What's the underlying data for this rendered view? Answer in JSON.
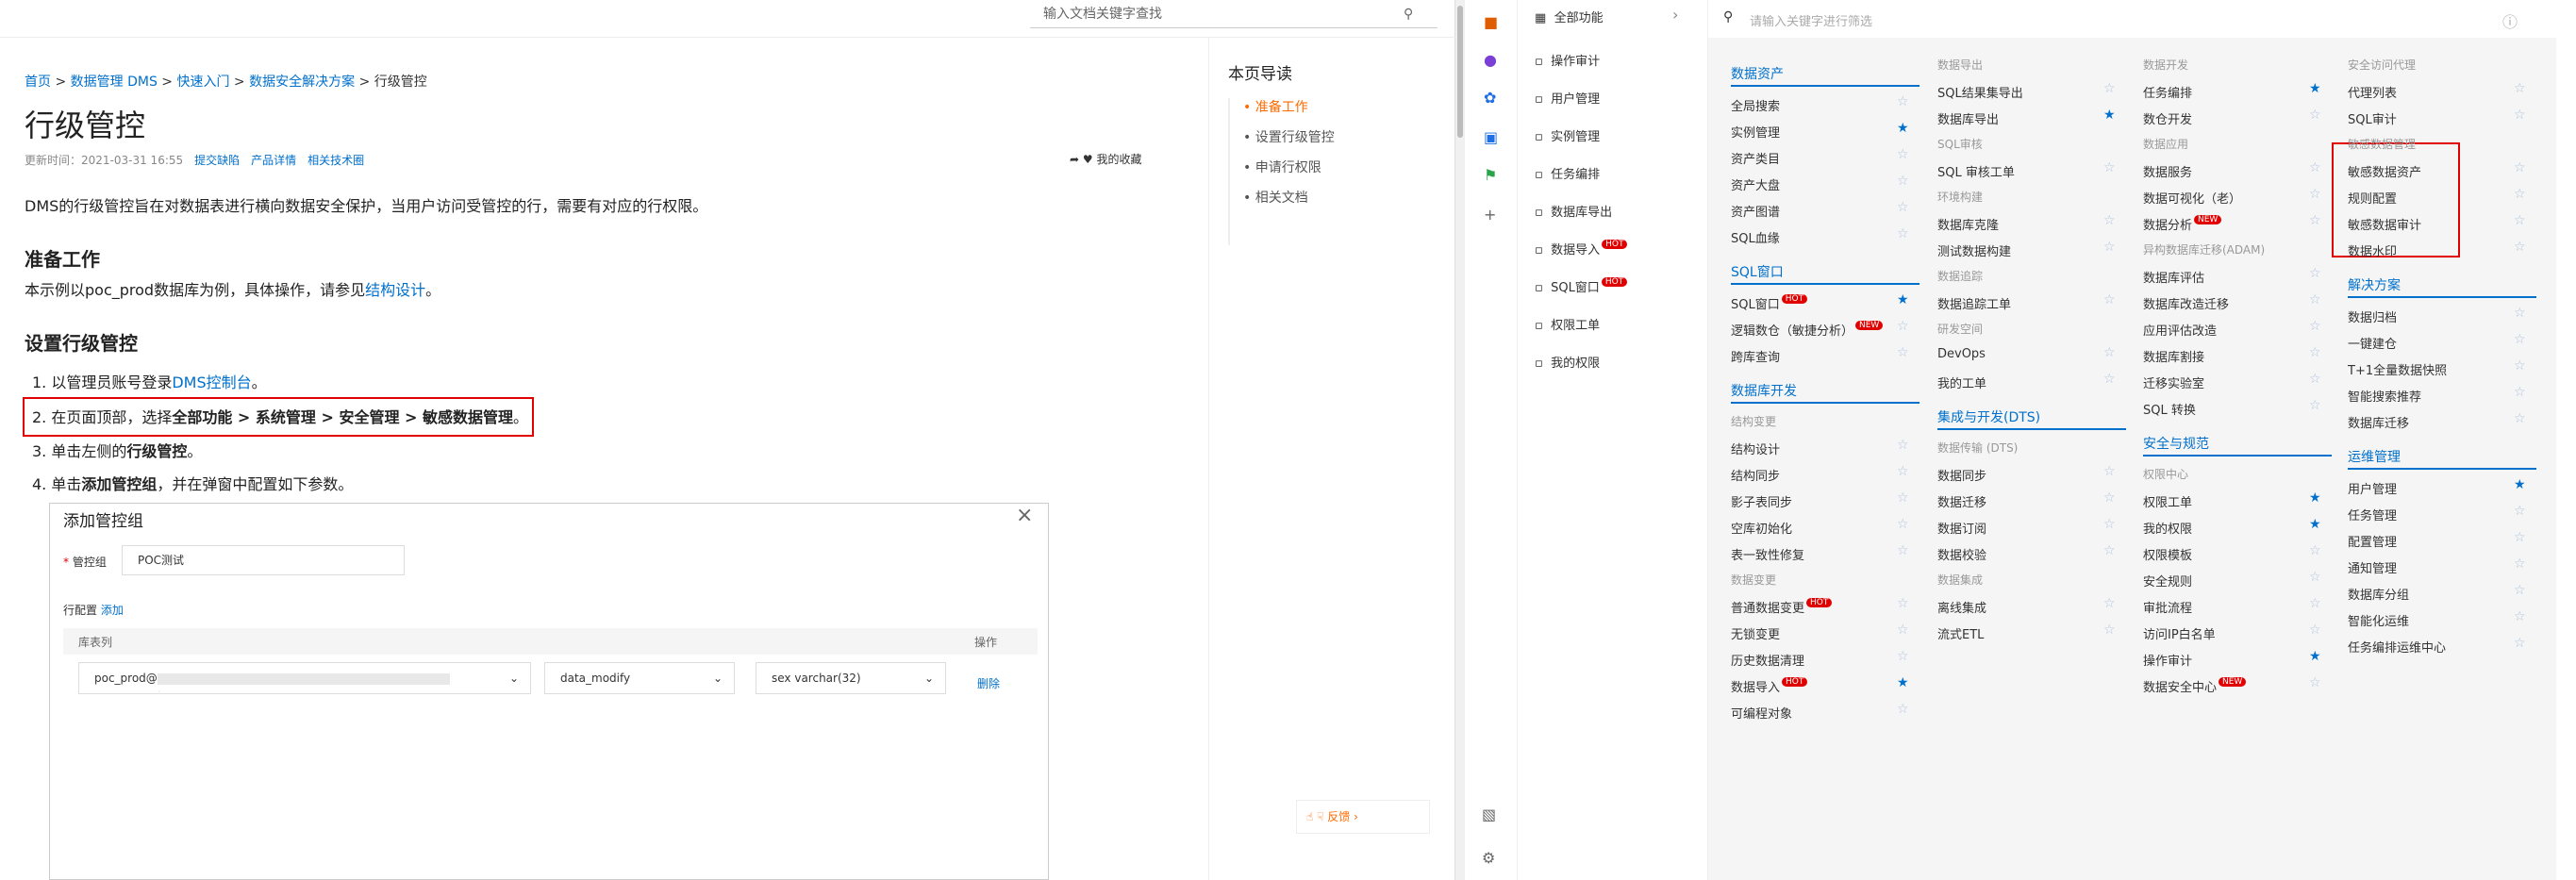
{
  "doc": {
    "search_placeholder": "输入文档关键字查找",
    "breadcrumb": [
      "首页",
      "数据管理 DMS",
      "快速入门",
      "数据安全解决方案",
      "行级管控"
    ],
    "title": "行级管控",
    "updated": "更新时间：2021-03-31 16:55",
    "links": [
      "提交缺陷",
      "产品详情",
      "相关技术圈"
    ],
    "fav": "我的收藏",
    "intro": "DMS的行级管控旨在对数据表进行横向数据安全保护，当用户访问受管控的行，需要有对应的行权限。",
    "prep_title": "准备工作",
    "prep_text": "本示例以poc_prod数据库为例，具体操作，请参见",
    "prep_link": "结构设计",
    "set_title": "设置行级管控",
    "s1a": "1. 以管理员账号登录",
    "s1b": "DMS控制台",
    "s2a": "2. 在页面顶部，选择",
    "s2b": "全部功能 > 系统管理 > 安全管理 > 敏感数据管理",
    "s3a": "3. 单击左侧的",
    "s3b": "行级管控",
    "s4a": "4. 单击",
    "s4b": "添加管控组",
    "s4c": "，并在弹窗中配置如下参数。",
    "dlg": {
      "title": "添加管控组",
      "grp_label": "管控组",
      "grp_value": "POC测试",
      "cfg_label": "行配置",
      "add": "添加",
      "col1": "库表列",
      "col2": "操作",
      "db": "poc_prod@",
      "op": "data_modify",
      "field": "sex varchar(32)",
      "del": "删除"
    },
    "toc_title": "本页导读",
    "toc": [
      "准备工作",
      "设置行级管控",
      "申请行权限",
      "相关文档"
    ],
    "feedback": "反馈"
  },
  "app": {
    "nav_head": "全部功能",
    "search_placeholder": "请输入关键字进行筛选",
    "nav": [
      {
        "label": "操作审计"
      },
      {
        "label": "用户管理"
      },
      {
        "label": "实例管理"
      },
      {
        "label": "任务编排"
      },
      {
        "label": "数据库导出"
      },
      {
        "label": "数据导入",
        "hot": "HOT"
      },
      {
        "label": "SQL窗口",
        "hot": "HOT"
      },
      {
        "label": "权限工单"
      },
      {
        "label": "我的权限"
      }
    ],
    "c1": [
      {
        "h": "数据资产"
      },
      {
        "i": "全局搜索"
      },
      {
        "i": "实例管理",
        "s": 1
      },
      {
        "i": "资产类目"
      },
      {
        "i": "资产大盘"
      },
      {
        "i": "资产图谱"
      },
      {
        "i": "SQL血缘"
      },
      {
        "h": "SQL窗口"
      },
      {
        "i": "SQL窗口",
        "hot": "HOT",
        "s": 1
      },
      {
        "i": "逻辑数仓（敏捷分析）",
        "hot": "NEW"
      },
      {
        "i": "跨库查询"
      },
      {
        "h": "数据库开发"
      },
      {
        "sub": "结构变更"
      },
      {
        "i": "结构设计"
      },
      {
        "i": "结构同步"
      },
      {
        "i": "影子表同步"
      },
      {
        "i": "空库初始化"
      },
      {
        "i": "表一致性修复"
      },
      {
        "sub": "数据变更"
      },
      {
        "i": "普通数据变更",
        "hot": "HOT"
      },
      {
        "i": "无锁变更"
      },
      {
        "i": "历史数据清理"
      },
      {
        "i": "数据导入",
        "hot": "HOT",
        "s": 1
      },
      {
        "i": "可编程对象"
      }
    ],
    "c2": [
      {
        "sub": "数据导出"
      },
      {
        "i": "SQL结果集导出"
      },
      {
        "i": "数据库导出",
        "s": 1
      },
      {
        "sub": "SQL审核"
      },
      {
        "i": "SQL 审核工单"
      },
      {
        "sub": "环境构建"
      },
      {
        "i": "数据库克隆"
      },
      {
        "i": "测试数据构建"
      },
      {
        "sub": "数据追踪"
      },
      {
        "i": "数据追踪工单"
      },
      {
        "sub": "研发空间"
      },
      {
        "i": "DevOps"
      },
      {
        "i": "我的工单"
      },
      {
        "h": "集成与开发(DTS)"
      },
      {
        "sub": "数据传输 (DTS)"
      },
      {
        "i": "数据同步"
      },
      {
        "i": "数据迁移"
      },
      {
        "i": "数据订阅"
      },
      {
        "i": "数据校验"
      },
      {
        "sub": "数据集成"
      },
      {
        "i": "离线集成"
      },
      {
        "i": "流式ETL"
      }
    ],
    "c3": [
      {
        "sub": "数据开发"
      },
      {
        "i": "任务编排",
        "s": 1
      },
      {
        "i": "数仓开发"
      },
      {
        "sub": "数据应用"
      },
      {
        "i": "数据服务"
      },
      {
        "i": "数据可视化（老）"
      },
      {
        "i": "数据分析",
        "hot": "NEW"
      },
      {
        "sub": "异构数据库迁移(ADAM)"
      },
      {
        "i": "数据库评估"
      },
      {
        "i": "数据库改造迁移"
      },
      {
        "i": "应用评估改造"
      },
      {
        "i": "数据库割接"
      },
      {
        "i": "迁移实验室"
      },
      {
        "i": "SQL 转换"
      },
      {
        "h": "安全与规范"
      },
      {
        "sub": "权限中心"
      },
      {
        "i": "权限工单",
        "s": 1
      },
      {
        "i": "我的权限",
        "s": 1
      },
      {
        "i": "权限模板"
      },
      {
        "i": "安全规则"
      },
      {
        "i": "审批流程"
      },
      {
        "i": "访问IP白名单"
      },
      {
        "i": "操作审计",
        "s": 1
      },
      {
        "i": "数据安全中心",
        "hot": "NEW"
      }
    ],
    "c4": [
      {
        "sub": "安全访问代理"
      },
      {
        "i": "代理列表"
      },
      {
        "i": "SQL审计"
      },
      {
        "sub": "敏感数据管理"
      },
      {
        "i": "敏感数据资产"
      },
      {
        "i": "规则配置"
      },
      {
        "i": "敏感数据审计"
      },
      {
        "i": "数据水印"
      },
      {
        "h": "解决方案"
      },
      {
        "i": "数据归档"
      },
      {
        "i": "一键建仓"
      },
      {
        "i": "T+1全量数据快照"
      },
      {
        "i": "智能搜索推荐"
      },
      {
        "i": "数据库迁移"
      },
      {
        "h": "运维管理"
      },
      {
        "i": "用户管理",
        "s": 1
      },
      {
        "i": "任务管理"
      },
      {
        "i": "配置管理"
      },
      {
        "i": "通知管理"
      },
      {
        "i": "数据库分组"
      },
      {
        "i": "智能化运维"
      },
      {
        "i": "任务编排运维中心"
      }
    ]
  }
}
